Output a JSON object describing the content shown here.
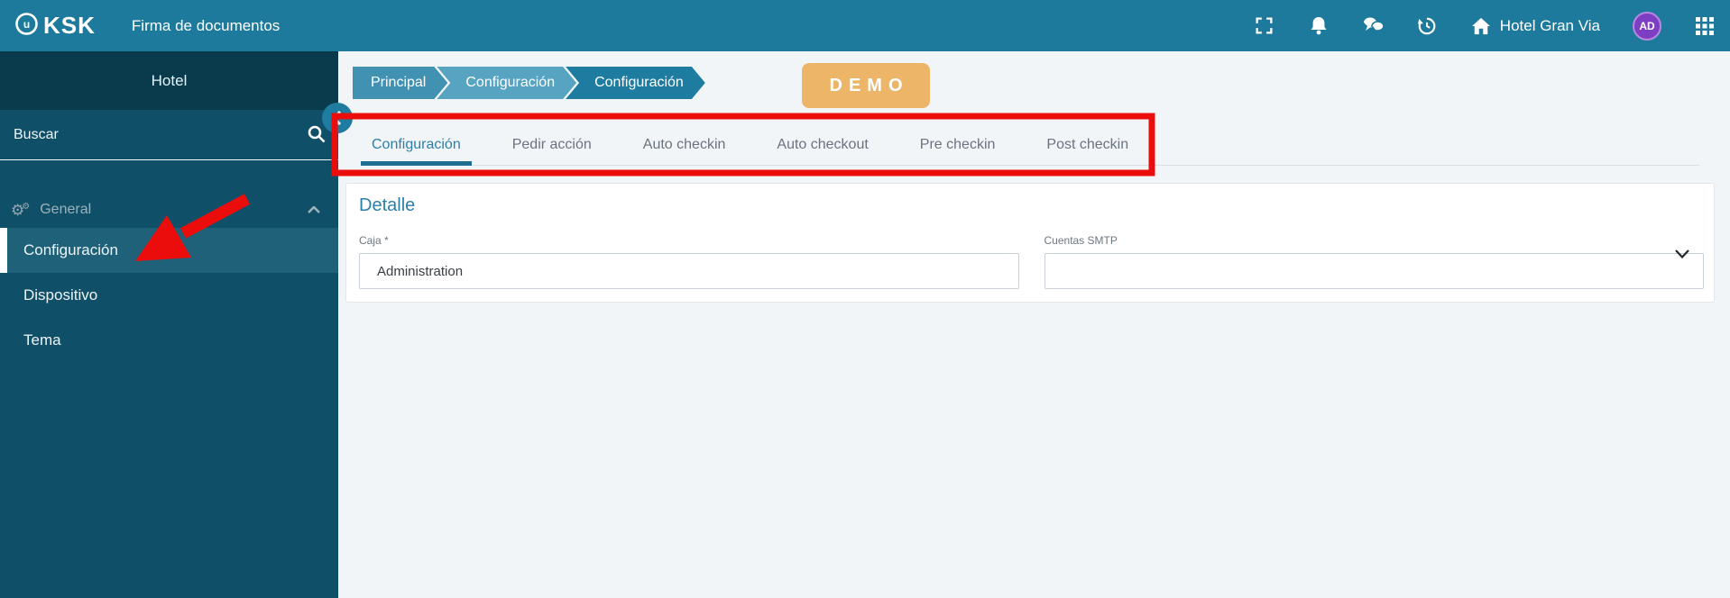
{
  "navbar": {
    "logo_text": "KSK",
    "app_title": "Firma de documentos",
    "hotel_name": "Hotel Gran Via",
    "avatar_initials": "AD",
    "icons": [
      "fullscreen-icon",
      "bell-icon",
      "chat-icon",
      "history-icon",
      "home-icon",
      "grid-icon"
    ]
  },
  "sidebar": {
    "hotel_header": "Hotel",
    "search_placeholder": "Buscar",
    "section": {
      "label": "General",
      "icon": "gears-icon",
      "expanded": true
    },
    "items": [
      {
        "label": "Configuración",
        "active": true
      },
      {
        "label": "Dispositivo",
        "active": false
      },
      {
        "label": "Tema",
        "active": false
      }
    ]
  },
  "breadcrumb": {
    "items": [
      {
        "label": "Principal"
      },
      {
        "label": "Configuración"
      },
      {
        "label": "Configuración"
      }
    ]
  },
  "demo_badge": {
    "label": "DEMO"
  },
  "tabs": {
    "items": [
      {
        "label": "Configuración",
        "active": true
      },
      {
        "label": "Pedir acción",
        "active": false
      },
      {
        "label": "Auto checkin",
        "active": false
      },
      {
        "label": "Auto checkout",
        "active": false
      },
      {
        "label": "Pre checkin",
        "active": false
      },
      {
        "label": "Post checkin",
        "active": false
      }
    ]
  },
  "detail": {
    "title": "Detalle",
    "caja": {
      "label": "Caja *",
      "value": "Administration"
    },
    "smtp": {
      "label": "Cuentas SMTP",
      "value": ""
    }
  },
  "colors": {
    "navbar": "#1d7a9c",
    "sidebar": "#0f4f68",
    "sidebar_header": "#0a3b4d",
    "active_item": "#1e6179",
    "accent": "#2c80a8",
    "tab_underline": "#1f6e94",
    "demo_badge": "#ecb567",
    "annotation_red": "#ea0d0c",
    "avatar": "#7e3ec4",
    "breadcrumb_1": "#4191b2",
    "breadcrumb_2": "#57a3c2",
    "breadcrumb_3": "#1e7ca1"
  }
}
